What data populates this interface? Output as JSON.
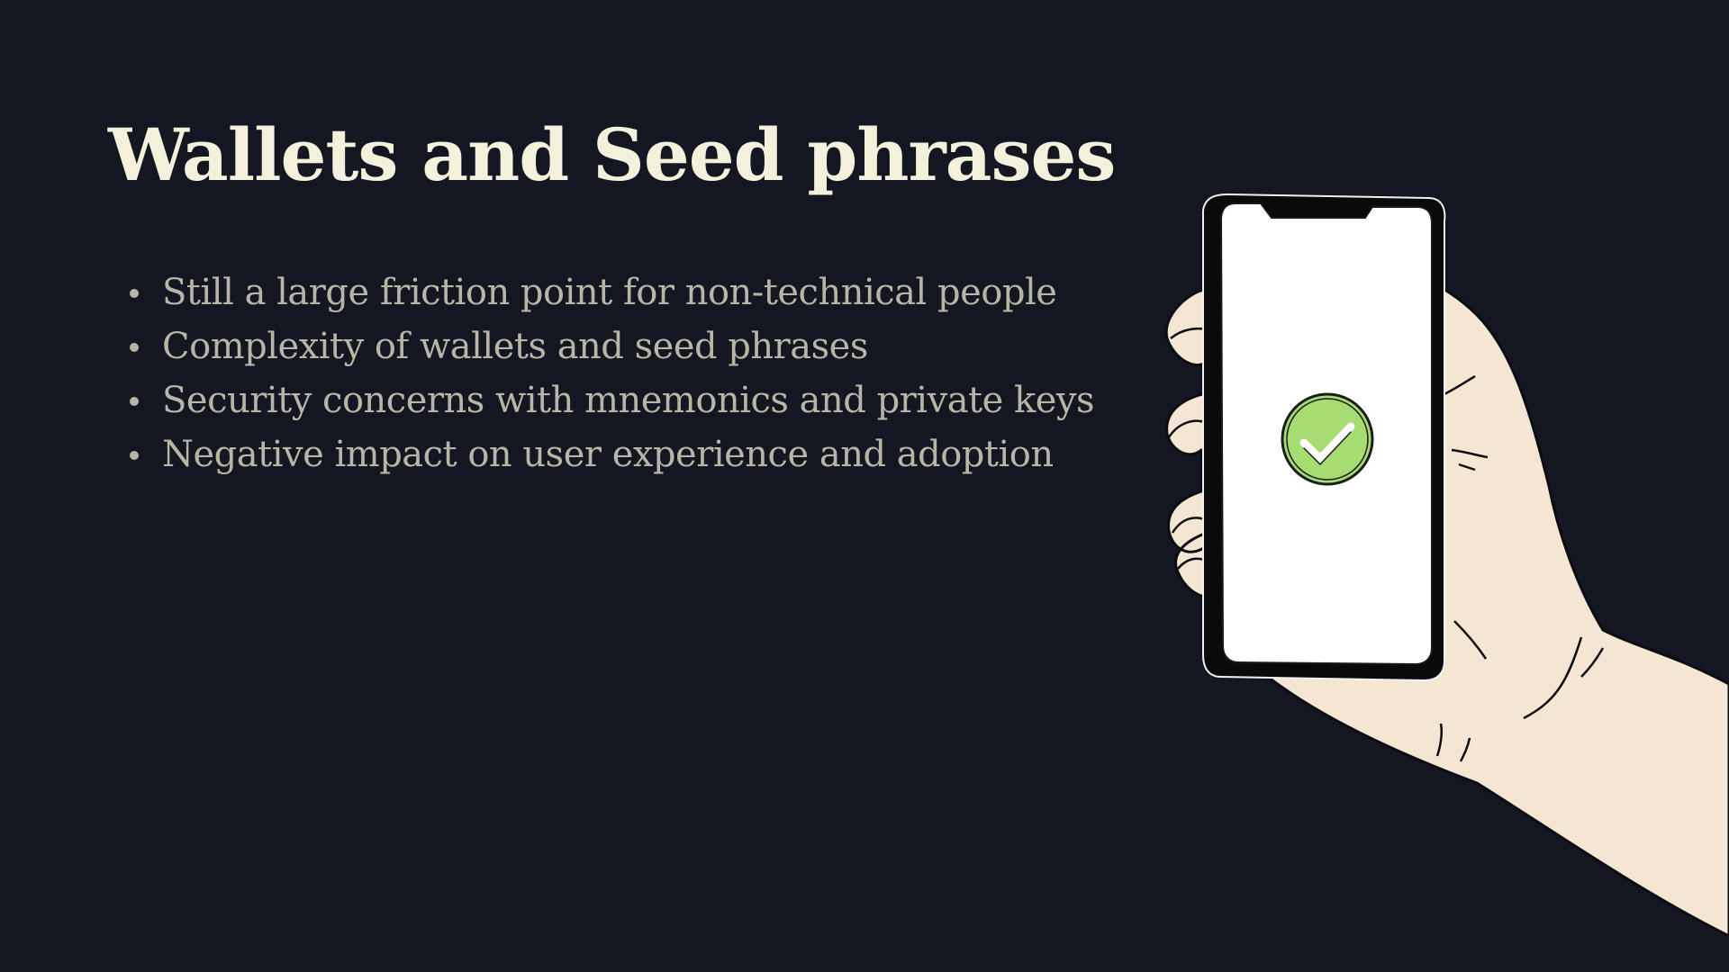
{
  "slide": {
    "title": "Wallets and Seed phrases",
    "bullets": [
      "Still a large friction point for non-technical people",
      "Complexity of wallets and seed phrases",
      "Security concerns with mnemonics and private keys",
      "Negative impact on user experience and adoption"
    ]
  },
  "illustration": {
    "subject": "hand holding smartphone",
    "icon": "check-circle-icon",
    "colors": {
      "background": "#141721",
      "skin": "#f5e6d3",
      "phone": "#0a0a0a",
      "screen": "#ffffff",
      "check": "#a6dc72"
    }
  }
}
